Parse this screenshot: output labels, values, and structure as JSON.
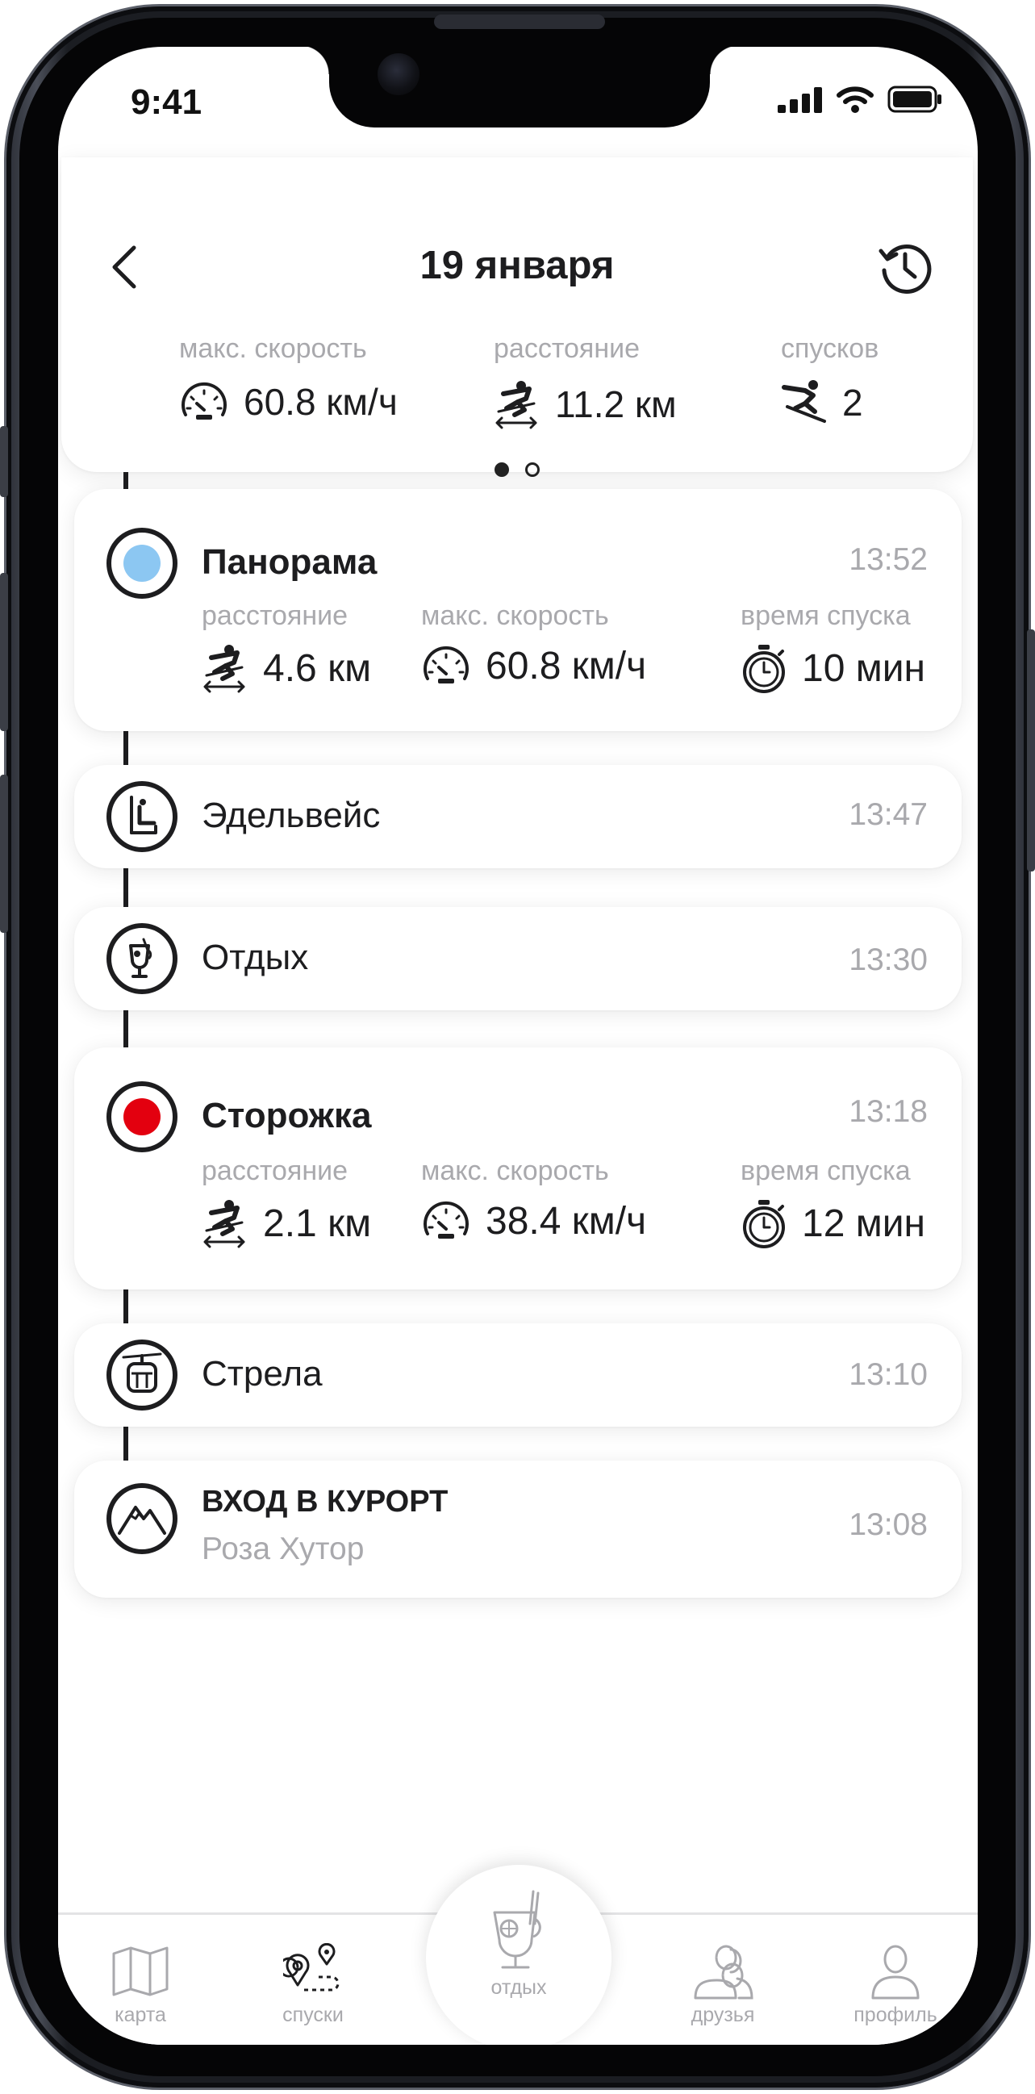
{
  "status_bar": {
    "time": "9:41"
  },
  "header": {
    "title": "19 января",
    "stats": [
      {
        "label": "макс. скорость",
        "value": "60.8 км/ч",
        "icon": "speedometer-icon"
      },
      {
        "label": "расстояние",
        "value": "11.2 км",
        "icon": "skier-icon"
      },
      {
        "label": "спусков",
        "value": "2",
        "icon": "skier-downhill-icon"
      }
    ],
    "pager": {
      "pages": 2,
      "active": 1
    }
  },
  "timeline": [
    {
      "type": "run",
      "title": "Панорама",
      "time": "13:52",
      "color": "#8cc7f2",
      "metrics": [
        {
          "label": "расстояние",
          "value": "4.6 км"
        },
        {
          "label": "макс. скорость",
          "value": "60.8 км/ч"
        },
        {
          "label": "время спуска",
          "value": "10 мин"
        }
      ]
    },
    {
      "type": "lift",
      "title": "Эдельвейс",
      "time": "13:47",
      "icon": "chairlift-icon"
    },
    {
      "type": "rest",
      "title": "Отдых",
      "time": "13:30",
      "icon": "mulled-wine-icon"
    },
    {
      "type": "run",
      "title": "Сторожка",
      "time": "13:18",
      "color": "#e3000f",
      "metrics": [
        {
          "label": "расстояние",
          "value": "2.1 км"
        },
        {
          "label": "макс. скорость",
          "value": "38.4 км/ч"
        },
        {
          "label": "время спуска",
          "value": "12 мин"
        }
      ]
    },
    {
      "type": "lift",
      "title": "Стрела",
      "time": "13:10",
      "icon": "gondola-icon"
    },
    {
      "type": "entry",
      "title": "ВХОД В КУРОРТ",
      "subtitle": "Роза Хутор",
      "time": "13:08",
      "icon": "mountain-icon"
    }
  ],
  "tabbar": {
    "items": [
      {
        "label": "карта",
        "icon": "map-icon",
        "active": false
      },
      {
        "label": "спуски",
        "icon": "route-icon",
        "active": true
      },
      {
        "label": "отдых",
        "icon": "mulled-wine-icon",
        "active": false
      },
      {
        "label": "друзья",
        "icon": "friends-icon",
        "active": false
      },
      {
        "label": "профиль",
        "icon": "profile-icon",
        "active": false
      }
    ]
  }
}
